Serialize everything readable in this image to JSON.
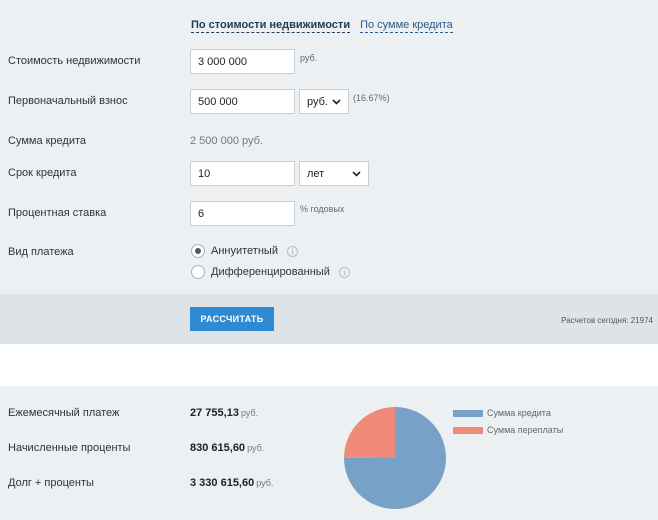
{
  "tabs": {
    "active": "По стоимости недвижимости",
    "other": "По сумме кредита"
  },
  "form": {
    "property_price": {
      "label": "Стоимость недвижимости",
      "value": "3 000 000",
      "unit": "руб."
    },
    "down_payment": {
      "label": "Первоначальный взнос",
      "value": "500 000",
      "unit_select": "руб.",
      "percent": "(16.67%)"
    },
    "loan_amount": {
      "label": "Сумма кредита",
      "value": "2 500 000 руб."
    },
    "term": {
      "label": "Срок кредита",
      "value": "10",
      "unit_select": "лет"
    },
    "rate": {
      "label": "Процентная ставка",
      "value": "6",
      "unit": "% годовых"
    },
    "payment_type": {
      "label": "Вид платежа",
      "options": [
        "Аннуитетный",
        "Дифференцированный"
      ],
      "selected": "Аннуитетный"
    }
  },
  "calculate_button": "РАССЧИТАТЬ",
  "counter_text": "Расчетов сегодня: 21974",
  "results": {
    "monthly": {
      "label": "Ежемесячный платеж",
      "value": "27 755,13",
      "unit": "руб."
    },
    "interest": {
      "label": "Начисленные проценты",
      "value": "830 615,60",
      "unit": "руб."
    },
    "total": {
      "label": "Долг + проценты",
      "value": "3 330 615,60",
      "unit": "руб."
    }
  },
  "chart_data": {
    "type": "pie",
    "slices": [
      {
        "label": "Сумма кредита",
        "value": 2500000,
        "color": "#77a1c7"
      },
      {
        "label": "Сумма переплаты",
        "value": 830615.6,
        "color": "#f08a78"
      }
    ]
  }
}
